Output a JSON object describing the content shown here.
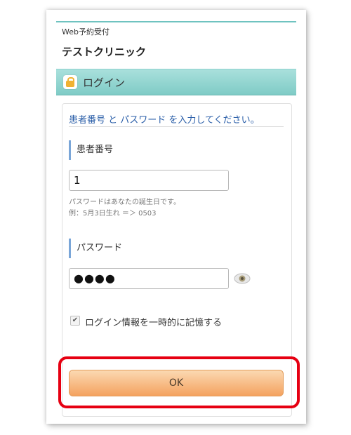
{
  "header": {
    "brand": "Web予約受付",
    "clinic_name": "テストクリニック"
  },
  "section": {
    "title": "ログイン",
    "icon": "lock-icon"
  },
  "form": {
    "instruction": "患者番号 と パスワード を入力してください。",
    "patient_id": {
      "label": "患者番号",
      "value": "1"
    },
    "hint_line1": "パスワードはあなたの誕生日です。",
    "hint_line2": "例：5月3日生れ ＝＞ 0503",
    "password": {
      "label": "パスワード",
      "masked_value": "●●●●",
      "toggle_icon": "eye-icon"
    },
    "remember": {
      "checked": true,
      "label": "ログイン情報を一時的に記憶する"
    },
    "submit_label": "OK"
  },
  "colors": {
    "accent_teal": "#7fcbc6",
    "highlight_red": "#e60012",
    "button_orange": "#f4a25f",
    "instruction_blue": "#2a5ea8"
  }
}
